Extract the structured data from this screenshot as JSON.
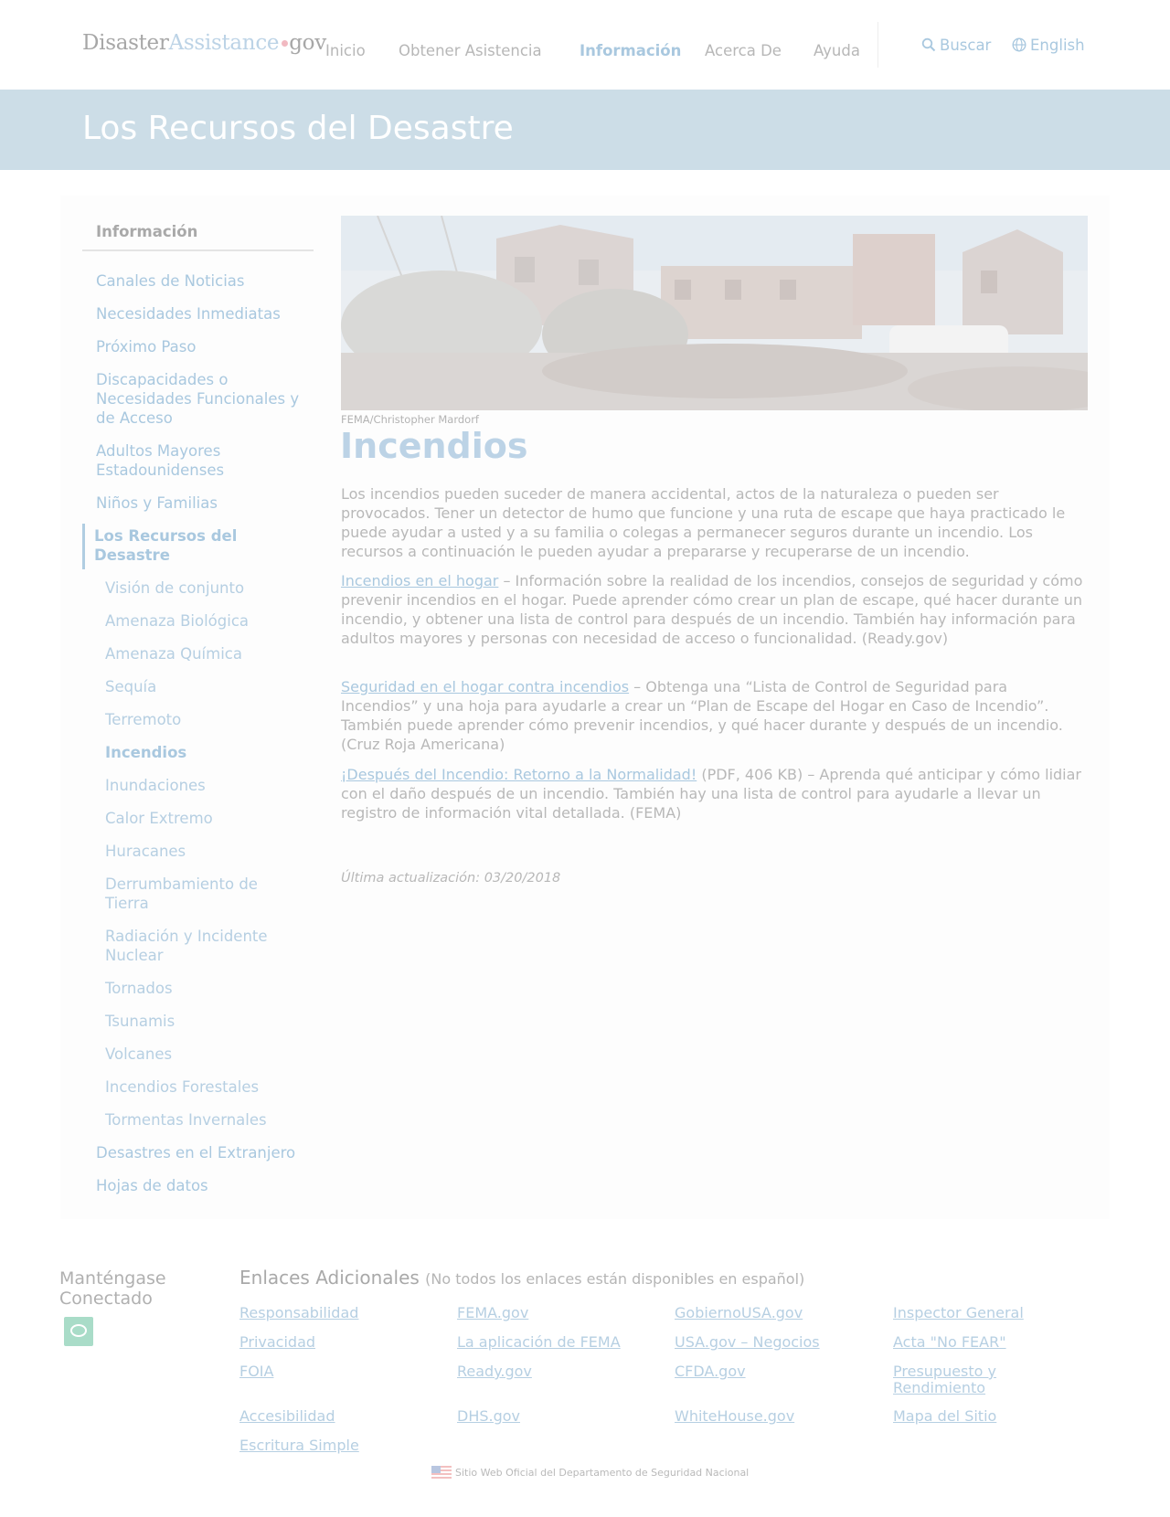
{
  "header": {
    "logo": {
      "part1": "Disaster",
      "part2": "Assistance",
      "part3": "gov"
    },
    "nav": [
      "Inicio",
      "Obtener Asistencia",
      "Información",
      "Acerca De",
      "Ayuda"
    ],
    "search_label": "Buscar",
    "language_label": "English"
  },
  "banner": {
    "title": "Los Recursos del Desastre"
  },
  "sidebar": {
    "title": "Información",
    "items": [
      "Canales de Noticias",
      "Necesidades Inmediatas",
      "Próximo Paso",
      "Discapacidades o Necesidades Funcionales y de Acceso",
      "Adultos Mayores Estadounidenses",
      "Niños y Familias",
      "Los Recursos del Desastre"
    ],
    "subitems": [
      "Visión de conjunto",
      "Amenaza Biológica",
      "Amenaza Química",
      "Sequía",
      "Terremoto",
      "Incendios",
      "Inundaciones",
      "Calor Extremo",
      "Huracanes",
      "Derrumbamiento de Tierra",
      "Radiación y Incidente Nuclear",
      "Tornados",
      "Tsunamis",
      "Volcanes",
      "Incendios Forestales",
      "Tormentas Invernales"
    ],
    "after_items": [
      "Desastres en el Extranjero",
      "Hojas de datos"
    ]
  },
  "content": {
    "caption": "FEMA/Christopher Mardorf",
    "title": "Incendios",
    "intro": "Los incendios pueden suceder de manera accidental, actos de la naturaleza o pueden ser provocados. Tener un detector de humo que funcione y una ruta de escape que haya practicado le puede ayudar a usted y a su familia o colegas a permanecer seguros durante un incendio. Los recursos a continuación le pueden ayudar a prepararse y recuperarse de un incendio.",
    "resources": [
      {
        "link": "Incendios en el hogar",
        "text": " – Información sobre la realidad de los incendios, consejos de seguridad y cómo prevenir incendios en el hogar. Puede aprender cómo crear un plan de escape, qué hacer durante un incendio, y obtener una lista de control para después de un incendio. También hay información para adultos mayores y personas con necesidad de acceso o funcionalidad. (Ready.gov)"
      },
      {
        "link": "Seguridad en el hogar contra incendios",
        "text": " – Obtenga una “Lista de Control de Seguridad para Incendios” y una hoja para ayudarle a crear un “Plan de Escape del Hogar en Caso de Incendio”. También puede aprender cómo prevenir incendios, y qué hacer durante y después de un incendio. (Cruz Roja Americana)"
      },
      {
        "link": "¡Después del Incendio: Retorno a la Normalidad!",
        "text": " (PDF, 406 KB) – Aprenda qué anticipar y cómo lidiar con el daño después de un incendio. También hay una lista de control para ayudarle a llevar un registro de información vital detallada. (FEMA)"
      }
    ],
    "updated": "Última actualización: 03/20/2018"
  },
  "footer": {
    "connect_title": "Manténgase Conectado",
    "links_title": "Enlaces Adicionales",
    "links_note": "(No todos los enlaces están disponibles en español)",
    "links": [
      [
        "Responsabilidad",
        "FEMA.gov",
        "GobiernoUSA.gov",
        "Inspector General"
      ],
      [
        "Privacidad",
        "La aplicación de FEMA",
        "USA.gov – Negocios",
        "Acta \"No FEAR\""
      ],
      [
        "FOIA",
        "Ready.gov",
        "CFDA.gov",
        "Presupuesto y Rendimiento"
      ],
      [
        "Accesibilidad",
        "DHS.gov",
        "WhiteHouse.gov",
        "Mapa del Sitio"
      ],
      [
        "Escritura Simple"
      ]
    ],
    "official": "Sitio Web Oficial del Departamento de Seguridad Nacional"
  }
}
